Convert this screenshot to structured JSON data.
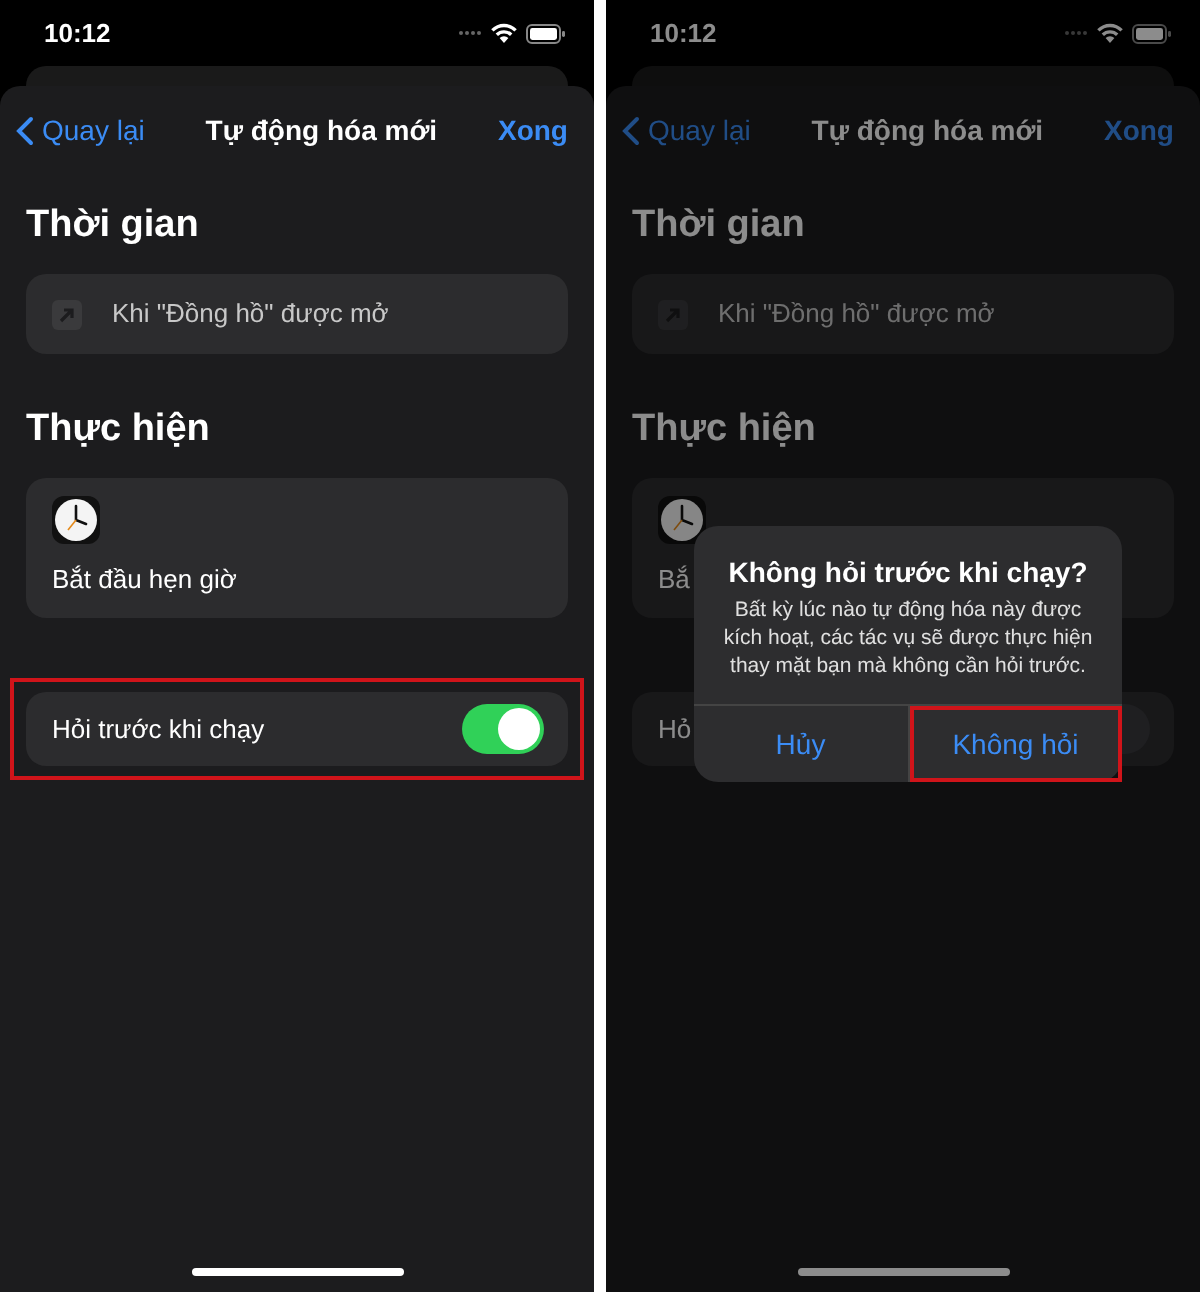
{
  "screens": [
    {
      "dimmed": false,
      "status_bar": {
        "time": "10:12"
      },
      "nav": {
        "back": "Quay lại",
        "title": "Tự động hóa mới",
        "done": "Xong"
      },
      "sections": [
        {
          "heading": "Thời gian",
          "card": {
            "kind": "trigger",
            "text": "Khi \"Đồng hồ\" được mở"
          }
        },
        {
          "heading": "Thực hiện",
          "card": {
            "kind": "action",
            "text": "Bắt đầu hẹn giờ"
          }
        }
      ],
      "toggle_row": {
        "label": "Hỏi trước khi chạy",
        "on": true,
        "highlighted": true
      }
    },
    {
      "dimmed": true,
      "status_bar": {
        "time": "10:12"
      },
      "nav": {
        "back": "Quay lại",
        "title": "Tự động hóa mới",
        "done": "Xong"
      },
      "sections": [
        {
          "heading": "Thời gian",
          "card": {
            "kind": "trigger",
            "text": "Khi \"Đồng hồ\" được mở"
          }
        },
        {
          "heading": "Thực hiện",
          "card": {
            "kind": "action",
            "text": "Bắ"
          }
        }
      ],
      "toggle_row": {
        "label": "Hỏ",
        "on": false,
        "highlighted": false
      },
      "alert": {
        "title": "Không hỏi trước khi chạy?",
        "message": "Bất kỳ lúc nào tự động hóa này được kích hoạt, các tác vụ sẽ được thực hiện thay mặt bạn mà không cần hỏi trước.",
        "buttons": [
          {
            "label": "Hủy",
            "highlighted": false
          },
          {
            "label": "Không hỏi",
            "highlighted": true
          }
        ]
      }
    }
  ]
}
